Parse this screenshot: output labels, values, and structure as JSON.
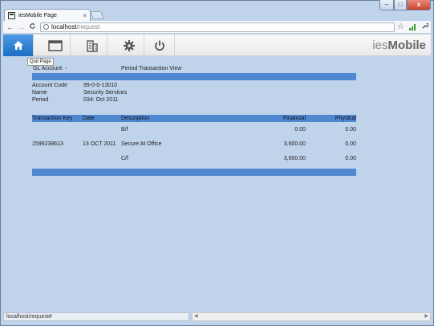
{
  "browser": {
    "tab_title": "iesMobile Page",
    "tab_close": "×",
    "url_host": "localhost",
    "url_path": "/request",
    "back": "←",
    "forward": "→",
    "reload": "C",
    "window": {
      "minimize": "–",
      "maximize": "□",
      "close": "x"
    },
    "status_url": "localhost/request#"
  },
  "app": {
    "brand_light": "ies",
    "brand_bold": "Mobile",
    "tooltip": "Quit Page",
    "colors": {
      "accent": "#1d6fc3",
      "table_bar": "#4f87d1"
    }
  },
  "report": {
    "gl_account": "GL Account: -",
    "view_title": "Period Transaction View",
    "fields": [
      {
        "label": "Account Code",
        "value": "99-0-0-13010"
      },
      {
        "label": "Name",
        "value": "Security Services"
      },
      {
        "label": "Period",
        "value": "034: Oct 2011"
      }
    ],
    "columns": [
      "Transaction Key",
      "Date",
      "Description",
      "Financial",
      "Physical"
    ],
    "rows": [
      [
        "",
        "",
        "B/f",
        "0.00",
        "0.00"
      ],
      [
        "1599238613",
        "13 OCT 2011",
        "Secure At Office",
        "3,600.00",
        "0.00"
      ],
      [
        "",
        "",
        "C/f",
        "3,600.00",
        "0.00"
      ]
    ]
  }
}
